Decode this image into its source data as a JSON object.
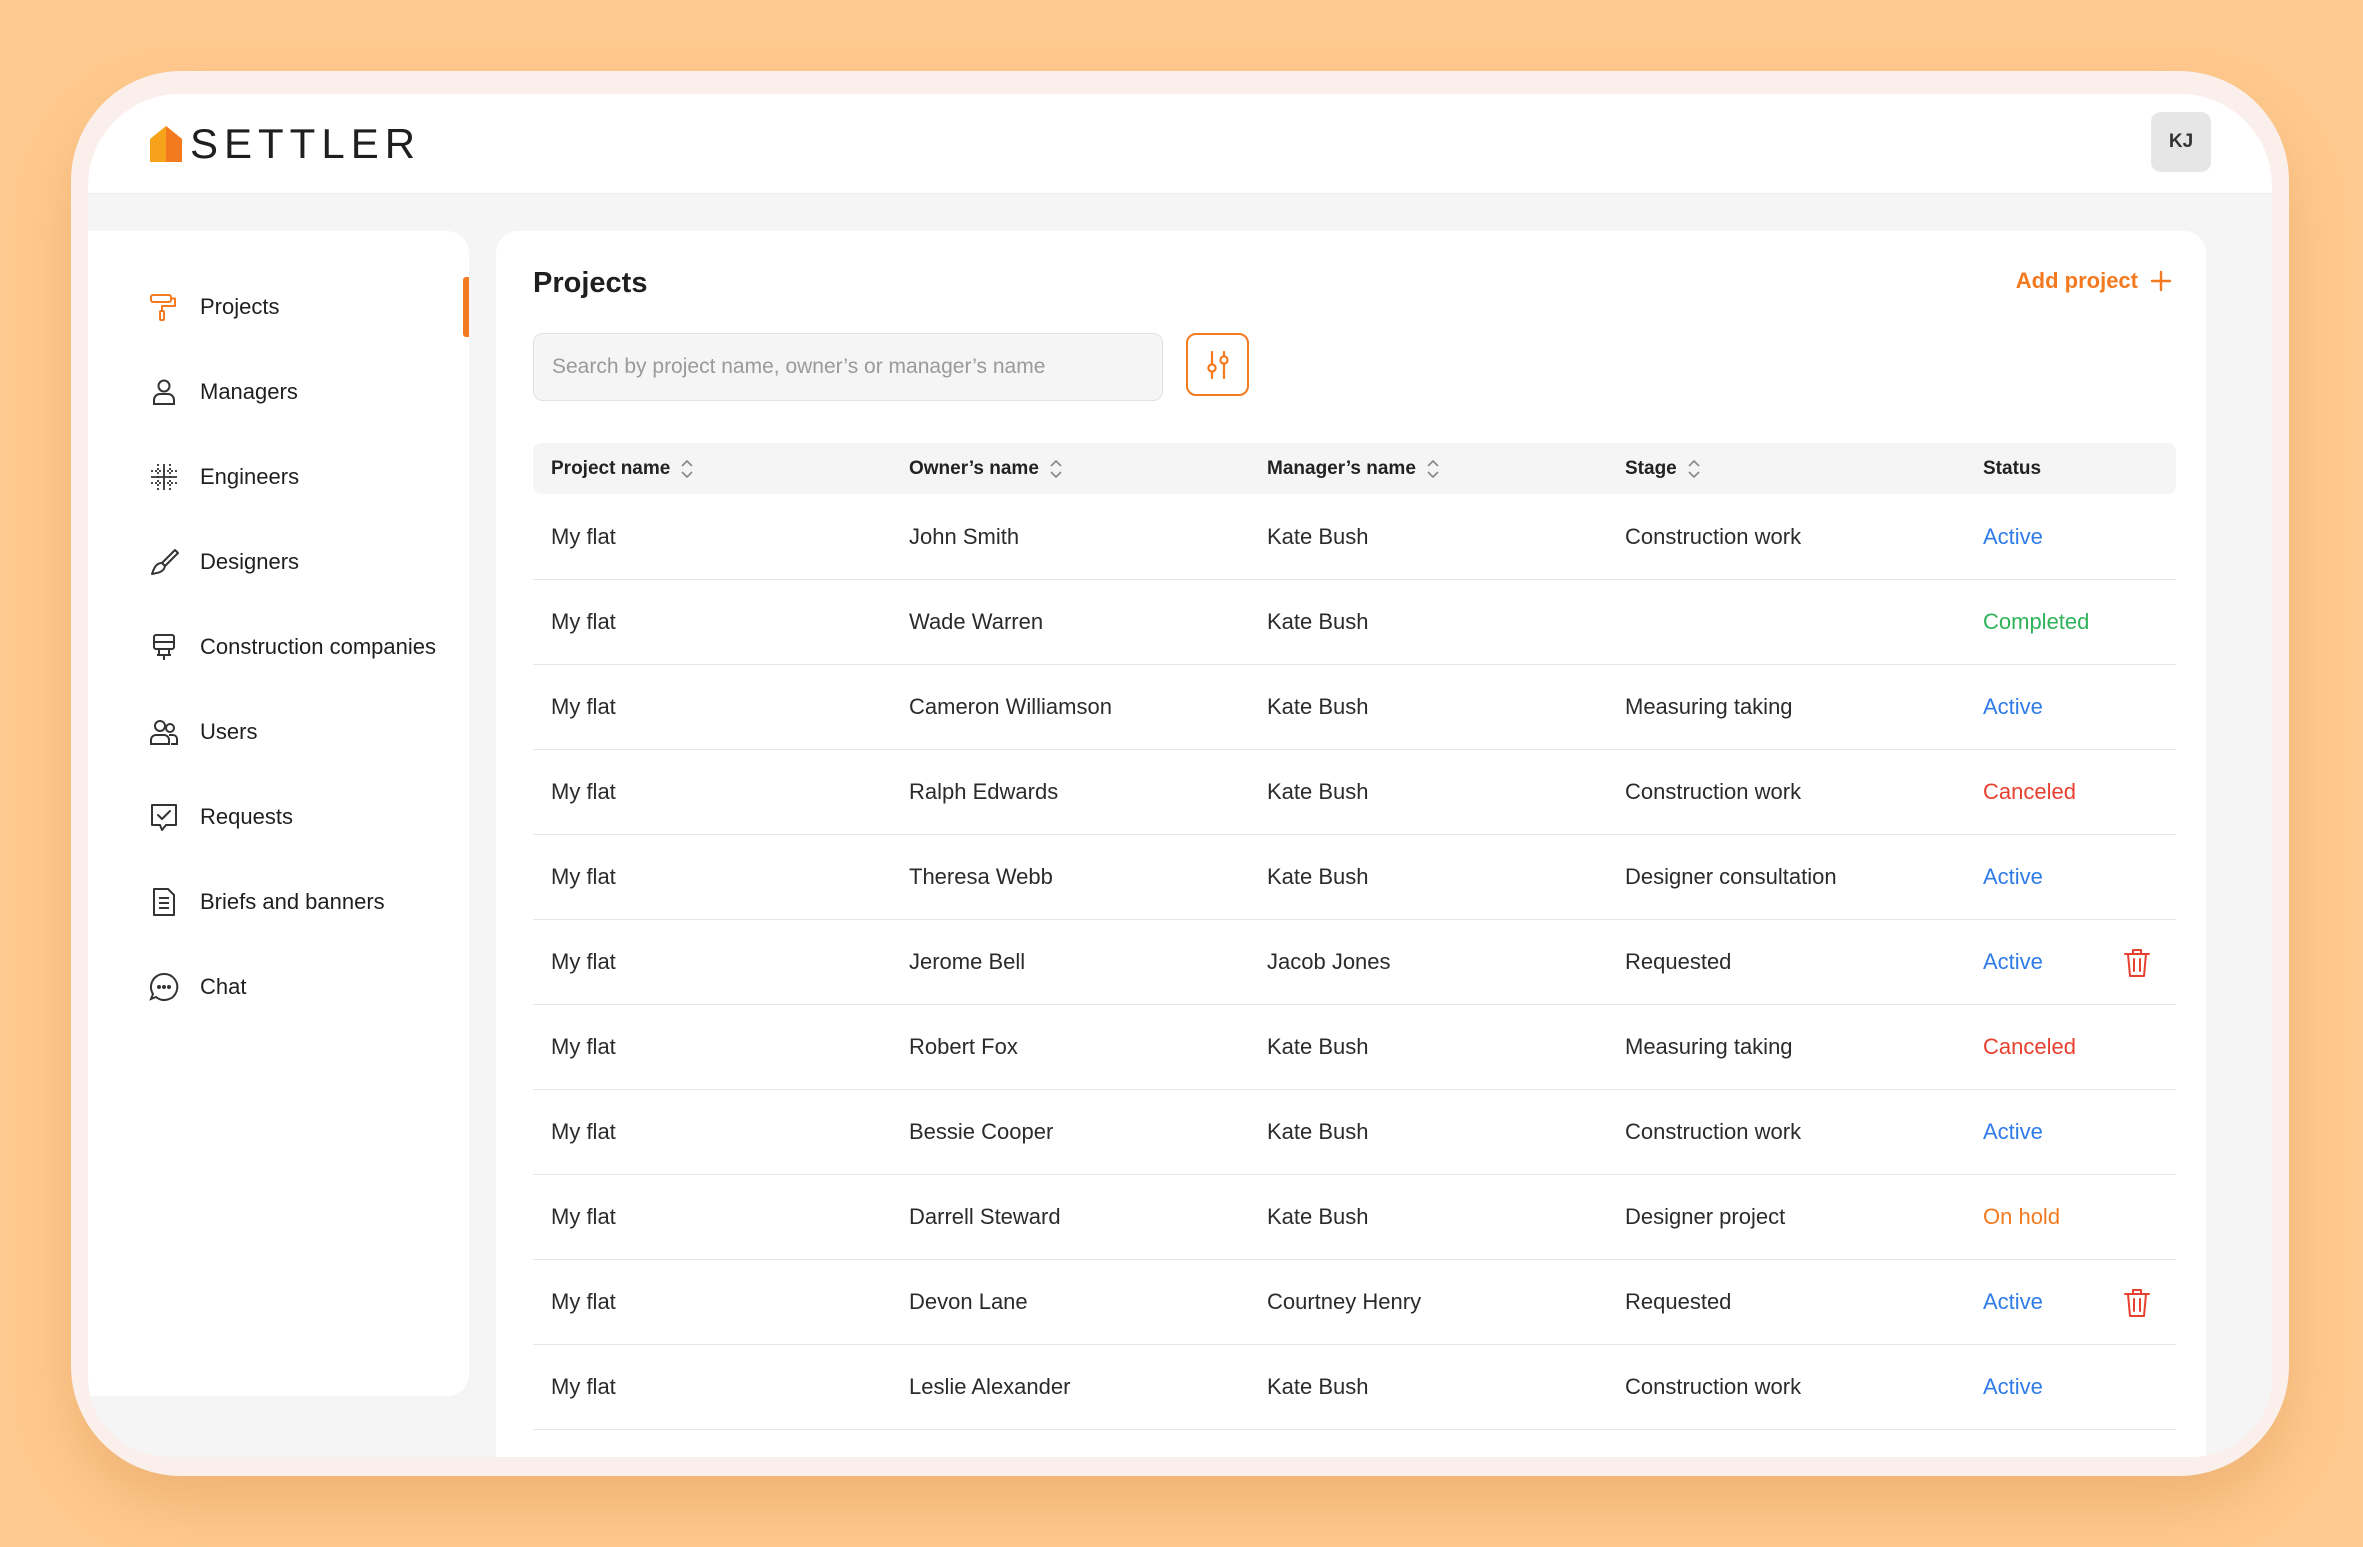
{
  "app": {
    "name": "SETTLER",
    "user_initials": "KJ"
  },
  "sidebar": {
    "items": [
      {
        "label": "Projects",
        "icon": "paint-roller-icon",
        "active": true
      },
      {
        "label": "Managers",
        "icon": "person-icon"
      },
      {
        "label": "Engineers",
        "icon": "grid-ruler-icon"
      },
      {
        "label": "Designers",
        "icon": "brush-icon"
      },
      {
        "label": "Construction companies",
        "icon": "easel-icon"
      },
      {
        "label": "Users",
        "icon": "users-icon"
      },
      {
        "label": "Requests",
        "icon": "checked-message-icon"
      },
      {
        "label": "Briefs and banners",
        "icon": "document-icon"
      },
      {
        "label": "Chat",
        "icon": "chat-bubble-icon"
      }
    ]
  },
  "main": {
    "title": "Projects",
    "add_label": "Add project",
    "search_placeholder": "Search by project name, owner’s or manager’s name",
    "columns": [
      "Project name",
      "Owner’s name",
      "Manager’s name",
      "Stage",
      "Status"
    ],
    "rows": [
      {
        "project": "My flat",
        "owner": "John Smith",
        "manager": "Kate Bush",
        "stage": "Construction work",
        "status": "Active",
        "kind": "active"
      },
      {
        "project": "My flat",
        "owner": "Wade Warren",
        "manager": "Kate Bush",
        "stage": "",
        "status": "Completed",
        "kind": "completed"
      },
      {
        "project": "My flat",
        "owner": "Cameron Williamson",
        "manager": "Kate Bush",
        "stage": "Measuring taking",
        "status": "Active",
        "kind": "active"
      },
      {
        "project": "My flat",
        "owner": "Ralph Edwards",
        "manager": "Kate Bush",
        "stage": "Construction work",
        "status": "Canceled",
        "kind": "canceled"
      },
      {
        "project": "My flat",
        "owner": "Theresa Webb",
        "manager": "Kate Bush",
        "stage": "Designer consultation",
        "status": "Active",
        "kind": "active"
      },
      {
        "project": "My flat",
        "owner": "Jerome Bell",
        "manager": "Jacob Jones",
        "stage": "Requested",
        "status": "Active",
        "kind": "active",
        "deletable": true
      },
      {
        "project": "My flat",
        "owner": "Robert Fox",
        "manager": "Kate Bush",
        "stage": "Measuring taking",
        "status": "Canceled",
        "kind": "canceled"
      },
      {
        "project": "My flat",
        "owner": "Bessie Cooper",
        "manager": "Kate Bush",
        "stage": "Construction work",
        "status": "Active",
        "kind": "active"
      },
      {
        "project": "My flat",
        "owner": "Darrell Steward",
        "manager": "Kate Bush",
        "stage": "Designer project",
        "status": "On hold",
        "kind": "onhold"
      },
      {
        "project": "My flat",
        "owner": "Devon Lane",
        "manager": "Courtney Henry",
        "stage": "Requested",
        "status": "Active",
        "kind": "active",
        "deletable": true
      },
      {
        "project": "My flat",
        "owner": "Leslie Alexander",
        "manager": "Kate Bush",
        "stage": "Construction work",
        "status": "Active",
        "kind": "active"
      }
    ]
  },
  "colors": {
    "accent": "#F47A20",
    "active": "#2F7BE8",
    "completed": "#2FB35A",
    "canceled": "#E8402E",
    "background": "#FFCA8F"
  }
}
